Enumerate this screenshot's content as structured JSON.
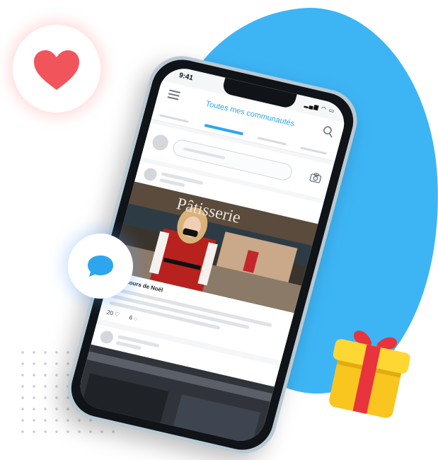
{
  "decor": {
    "heart_icon": "heart-icon",
    "chat_icon": "chat-bubble-icon",
    "gift_icon": "gift-box-icon",
    "blob_color": "#3db5f5"
  },
  "phone": {
    "status": {
      "time": "9:41",
      "icons": "signal wifi battery"
    },
    "header": {
      "title": "Toutes mes communautés",
      "menu_icon": "menu-icon",
      "search_icon": "search-icon"
    },
    "composer": {
      "camera_icon": "camera-icon"
    },
    "post": {
      "photo_sign": "Pâtisserie",
      "title": "Concours de Noël",
      "likes": "20",
      "comments": "6"
    },
    "accent_color": "#2ea6ee"
  }
}
